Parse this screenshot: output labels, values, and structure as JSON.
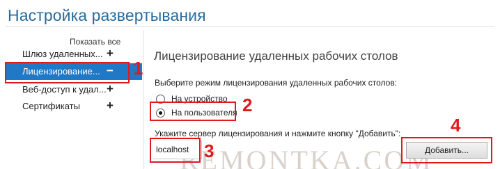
{
  "window": {
    "title": "Настройка развертывания"
  },
  "sidebar": {
    "show_all": "Показать все",
    "items": [
      {
        "label": "Шлюз удаленных...",
        "toggle": "+"
      },
      {
        "label": "Лицензирование...",
        "toggle": "−",
        "selected": true
      },
      {
        "label": "Веб-доступ к удал...",
        "toggle": "+"
      },
      {
        "label": "Сертификаты",
        "toggle": "+"
      }
    ]
  },
  "main": {
    "section_title": "Лицензирование удаленных рабочих столов",
    "mode_prompt": "Выберите режим лицензирования удаленных рабочих столов:",
    "modes": [
      {
        "label": "На устройство",
        "checked": false
      },
      {
        "label": "На пользователя",
        "checked": true
      }
    ],
    "server_hint": "Укажите сервер лицензирования и нажмите кнопку \"Добавить\":",
    "server_value": "localhost",
    "add_label": "Добавить..."
  },
  "annotations": {
    "step_1": "1",
    "step_2": "2",
    "step_3": "3",
    "step_4": "4",
    "highlight_color": "#e0191c"
  },
  "watermark": "REMONTKA.COM",
  "colors": {
    "title": "#2a6c9a",
    "selection": "#1f79c7"
  }
}
